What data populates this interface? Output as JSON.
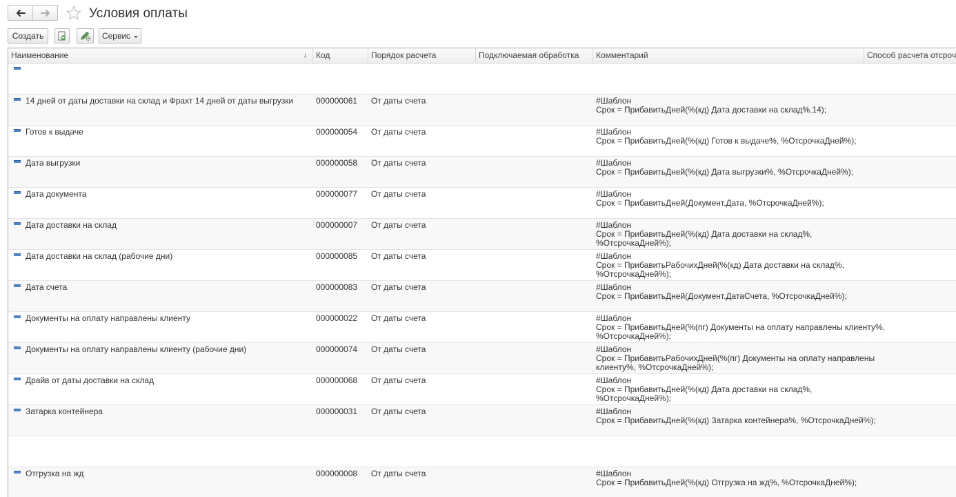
{
  "window": {
    "title": "Условия оплаты"
  },
  "toolbar": {
    "create_label": "Создать",
    "service_label": "Сервис"
  },
  "columns": {
    "name": "Наименование",
    "code": "Код",
    "order": "Порядок расчета",
    "handler": "Подключаемая обработка",
    "comment": "Комментарий",
    "deferral": "Способ расчета отсрочки"
  },
  "rows": [
    {
      "name": "",
      "code": "",
      "order": "",
      "comment": []
    },
    {
      "name": "14 дней от даты доставки на склад и Фрахт 14 дней от даты выгрузки",
      "code": "000000061",
      "order": "От даты счета",
      "comment": [
        "#Шаблон",
        "Срок = ПрибавитьДней(%(кд) Дата доставки на склад%,14);"
      ]
    },
    {
      "name": "Готов к выдаче",
      "code": "000000054",
      "order": "От даты счета",
      "comment": [
        "#Шаблон",
        "Срок = ПрибавитьДней(%(кд) Готов к выдаче%, %ОтсрочкаДней%);"
      ]
    },
    {
      "name": "Дата выгрузки",
      "code": "000000058",
      "order": "От даты счета",
      "comment": [
        "#Шаблон",
        "Срок = ПрибавитьДней(%(кд) Дата выгрузки%, %ОтсрочкаДней%);"
      ]
    },
    {
      "name": "Дата документа",
      "code": "000000077",
      "order": "От даты счета",
      "comment": [
        "#Шаблон",
        "Срок = ПрибавитьДней(Документ.Дата, %ОтсрочкаДней%);"
      ]
    },
    {
      "name": "Дата доставки на склад",
      "code": "000000007",
      "order": "От даты счета",
      "comment": [
        "#Шаблон",
        "Срок = ПрибавитьДней(%(кд) Дата доставки на склад%,",
        "%ОтсрочкаДней%);"
      ]
    },
    {
      "name": "Дата доставки на склад (рабочие дни)",
      "code": "000000085",
      "order": "От даты счета",
      "comment": [
        "#Шаблон",
        "Срок = ПрибавитьРабочихДней(%(кд) Дата доставки на склад%,",
        "%ОтсрочкаДней%);"
      ]
    },
    {
      "name": "Дата счета",
      "code": "000000083",
      "order": "От даты счета",
      "comment": [
        "#Шаблон",
        "Срок = ПрибавитьДней(Документ.ДатаСчета, %ОтсрочкаДней%);"
      ]
    },
    {
      "name": "Документы на оплату направлены клиенту",
      "code": "000000022",
      "order": "От даты счета",
      "comment": [
        "#Шаблон",
        "Срок = ПрибавитьДней(%(пг) Документы на оплату направлены клиенту%,",
        "%ОтсрочкаДней%);"
      ]
    },
    {
      "name": "Документы на оплату направлены клиенту (рабочие дни)",
      "code": "000000074",
      "order": "От даты счета",
      "comment": [
        "#Шаблон",
        "Срок = ПрибавитьРабочихДней(%(пг) Документы на оплату направлены",
        "клиенту%, %ОтсрочкаДней%);"
      ]
    },
    {
      "name": "Драйв от даты доставки на склад",
      "code": "000000068",
      "order": "От даты счета",
      "comment": [
        "#Шаблон",
        "Срок = ПрибавитьДней(%(кд) Дата доставки на склад%,",
        "%ОтсрочкаДней%);"
      ]
    },
    {
      "name": "Затарка контейнера",
      "code": "000000031",
      "order": "От даты счета",
      "comment": [
        "#Шаблон",
        "Срок = ПрибавитьДней(%(кд) Затарка контейнера%, %ОтсрочкаДней%);"
      ]
    },
    {
      "name": "",
      "code": "",
      "order": "",
      "comment": [],
      "no_icon": true
    },
    {
      "name": "Отгрузка на жд",
      "code": "000000008",
      "order": "От даты счета",
      "comment": [
        "#Шаблон",
        "Срок = ПрибавитьДней(%(кд) Отгрузка на жд%, %ОтсрочкаДней%);"
      ]
    }
  ]
}
